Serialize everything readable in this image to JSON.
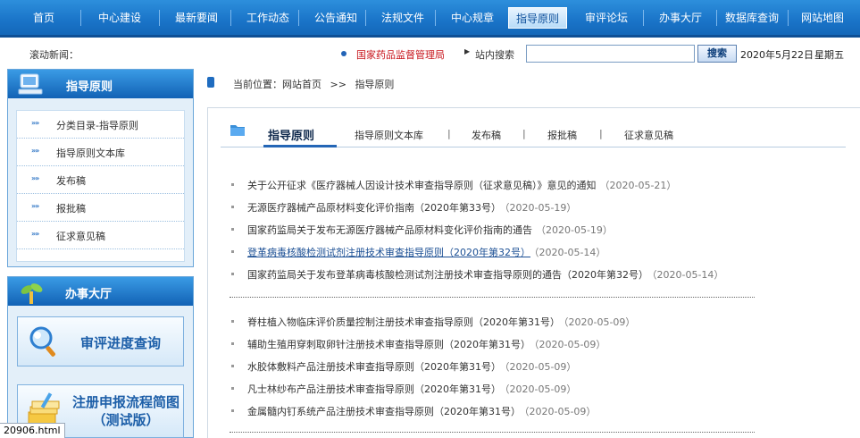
{
  "nav": {
    "items": [
      {
        "label": "首页"
      },
      {
        "label": "中心建设"
      },
      {
        "label": "最新要闻"
      },
      {
        "label": "工作动态"
      },
      {
        "label": "公告通知"
      },
      {
        "label": "法规文件"
      },
      {
        "label": "中心规章"
      },
      {
        "label": "指导原则",
        "active": true
      },
      {
        "label": "审评论坛"
      },
      {
        "label": "办事大厅"
      },
      {
        "label": "数据库查询"
      },
      {
        "label": "网站地图"
      }
    ]
  },
  "infobar": {
    "scroll_label": "滚动新闻：",
    "nmpa_link": "国家药品监督管理局",
    "search_label": "站内搜索",
    "search_value": "",
    "search_button": "搜索",
    "date": "2020年5月22日",
    "weekday": "星期五"
  },
  "sidebar": {
    "title": "指导原则",
    "items": [
      {
        "label": "分类目录-指导原则"
      },
      {
        "label": "指导原则文本库"
      },
      {
        "label": "发布稿"
      },
      {
        "label": "报批稿"
      },
      {
        "label": "征求意见稿"
      }
    ]
  },
  "service": {
    "title": "办事大厅",
    "progress_button": "审评进度查询",
    "flow_button_line1": "注册申报流程简图",
    "flow_button_line2": "（测试版）"
  },
  "breadcrumb": {
    "prefix": "当前位置：",
    "home": "网站首页",
    "sep": ">>",
    "current": "指导原则"
  },
  "tabs": {
    "active": "指导原则",
    "items": [
      {
        "label": "指导原则文本库"
      },
      {
        "label": "发布稿"
      },
      {
        "label": "报批稿"
      },
      {
        "label": "征求意见稿"
      }
    ],
    "separator": "|"
  },
  "news_group1": [
    {
      "title": "关于公开征求《医疗器械人因设计技术审查指导原则（征求意见稿）》意见的通知",
      "date": "（2020-05-21）"
    },
    {
      "title": "无源医疗器械产品原材料变化评价指南（2020年第33号）",
      "date": "（2020-05-19）"
    },
    {
      "title": "国家药监局关于发布无源医疗器械产品原材料变化评价指南的通告",
      "date": "（2020-05-19）"
    },
    {
      "title": "登革病毒核酸检测试剂注册技术审查指导原则（2020年第32号）",
      "date": "（2020-05-14）",
      "hover": true
    },
    {
      "title": "国家药监局关于发布登革病毒核酸检测试剂注册技术审查指导原则的通告（2020年第32号）",
      "date": "（2020-05-14）"
    }
  ],
  "news_group2": [
    {
      "title": "脊柱植入物临床评价质量控制注册技术审查指导原则（2020年第31号）",
      "date": "（2020-05-09）"
    },
    {
      "title": "辅助生殖用穿刺取卵针注册技术审查指导原则（2020年第31号）",
      "date": "（2020-05-09）"
    },
    {
      "title": "水胶体敷料产品注册技术审查指导原则（2020年第31号）",
      "date": "（2020-05-09）"
    },
    {
      "title": "凡士林纱布产品注册技术审查指导原则（2020年第31号）",
      "date": "（2020-05-09）"
    },
    {
      "title": "金属髓内钉系统产品注册技术审查指导原则（2020年第31号）",
      "date": "（2020-05-09）"
    }
  ],
  "status": {
    "text": "20906.html"
  },
  "colors": {
    "nav_blue": "#1a74c8",
    "link_red": "#c8171e",
    "accent_blue": "#2466b6"
  }
}
